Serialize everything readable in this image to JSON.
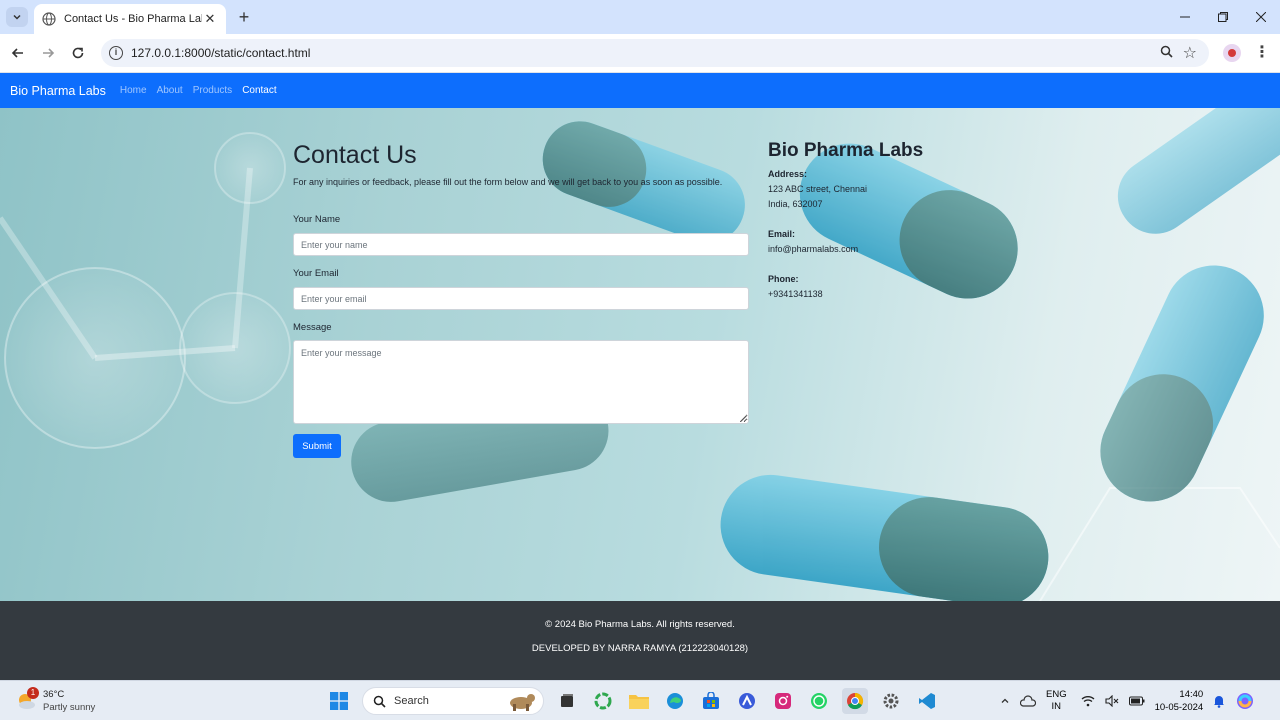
{
  "browser": {
    "tab_title": "Contact Us - Bio Pharma Labs",
    "url": "127.0.0.1:8000/static/contact.html",
    "icons": [
      "tab-search-chevron",
      "globe",
      "close",
      "new-tab-plus",
      "minimize",
      "maximize",
      "window-close",
      "back-arrow",
      "forward-arrow",
      "reload",
      "site-info",
      "zoom",
      "bookmark-star",
      "profile",
      "more-menu"
    ]
  },
  "navbar": {
    "brand": "Bio Pharma Labs",
    "links": [
      {
        "label": "Home",
        "active": false
      },
      {
        "label": "About",
        "active": false
      },
      {
        "label": "Products",
        "active": false
      },
      {
        "label": "Contact",
        "active": true
      }
    ],
    "background": "#0d6efd"
  },
  "contact": {
    "title": "Contact Us",
    "intro": "For any inquiries or feedback, please fill out the form below and we will get back to you as soon as possible.",
    "name_label": "Your Name",
    "name_placeholder": "Enter your name",
    "email_label": "Your Email",
    "email_placeholder": "Enter your email",
    "message_label": "Message",
    "message_placeholder": "Enter your message",
    "submit_label": "Submit"
  },
  "info": {
    "title": "Bio Pharma Labs",
    "address_label": "Address:",
    "address_line1": "123 ABC street, Chennai",
    "address_line2": "India, 632007",
    "email_label": "Email:",
    "email": "info@pharmalabs.com",
    "phone_label": "Phone:",
    "phone": "+9341341138"
  },
  "footer": {
    "copyright": "© 2024 Bio Pharma Labs. All rights reserved.",
    "developer": "DEVELOPED BY NARRA RAMYA (212223040128)",
    "background": "#343a40"
  },
  "taskbar": {
    "weather_badge": "1",
    "temperature": "36°C",
    "weather": "Partly sunny",
    "search_label": "Search",
    "language_line1": "ENG",
    "language_line2": "IN",
    "time": "14:40",
    "date": "10-05-2024",
    "apps": [
      "windows-start",
      "search",
      "task-view",
      "copilot",
      "file-explorer",
      "edge",
      "store",
      "arc",
      "instagram",
      "whatsapp",
      "chrome",
      "settings",
      "vscode"
    ]
  }
}
